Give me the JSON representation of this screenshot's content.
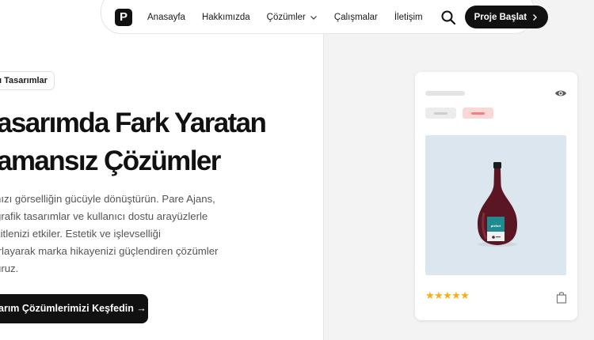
{
  "nav": {
    "logo_letter": "P",
    "links": [
      "Anasayfa",
      "Hakkımızda",
      "Çözümler",
      "Çalışmalar",
      "İletişim"
    ],
    "cta": "Proje Başlat"
  },
  "hero": {
    "badge": "ı Tasarımlar",
    "title_line1": "asarımda Fark Yaratan",
    "title_line2": "amansız Çözümler",
    "paragraph": [
      "nızı görselliğin gücüyle dönüştürün. Pare Ajans,",
      "grafik tasarımlar ve kullanıcı dostu arayüzlerle",
      "kitlenizi etkiler. Estetik ve işlevselliği",
      "ırlayarak marka hikayenizi güçlendiren çözümler",
      "uruz."
    ],
    "cta": "arım Çözümlerimizi Keşfedin →"
  },
  "card": {
    "rating": 5,
    "stars": "★★★★★",
    "bottle_label": "pixfort",
    "colors": {
      "accent": "#f5b014",
      "image_bg": "#dce6ef",
      "chip_red": "#f08080"
    }
  }
}
